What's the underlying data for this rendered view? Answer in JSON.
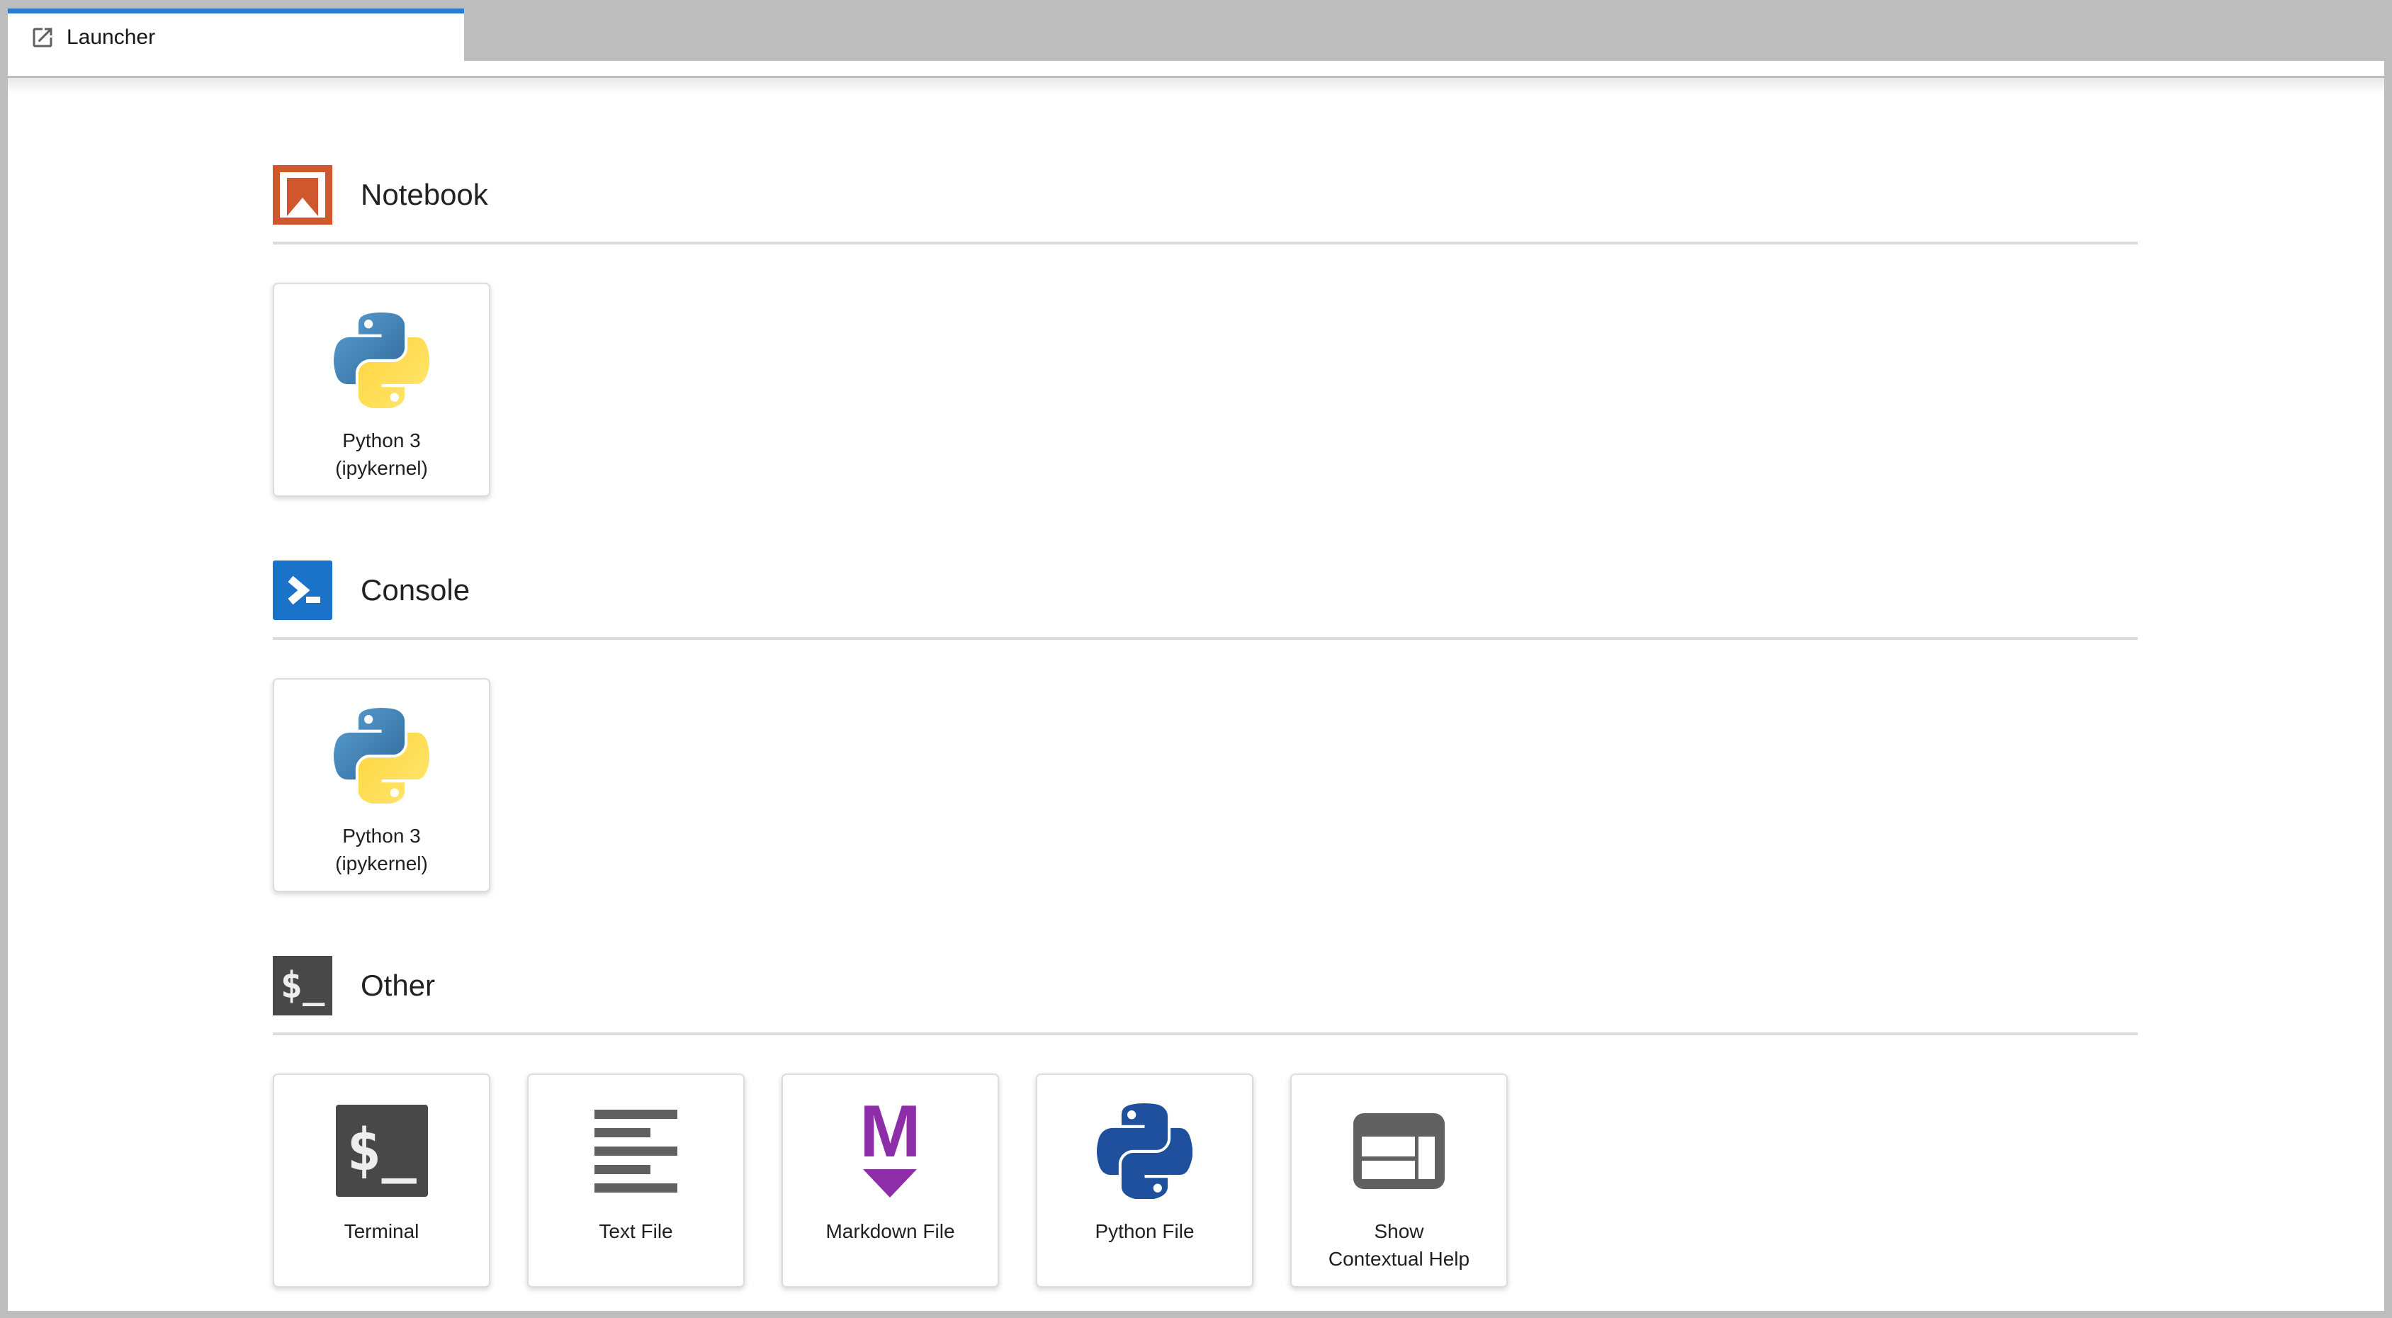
{
  "tab": {
    "label": "Launcher"
  },
  "sections": [
    {
      "label": "Notebook",
      "icon": "notebook-icon",
      "cards": [
        {
          "name": "Python 3 (ipykernel)",
          "icon": "python-logo-icon",
          "lines": [
            "Python 3",
            "(ipykernel)"
          ]
        }
      ]
    },
    {
      "label": "Console",
      "icon": "console-icon",
      "cards": [
        {
          "name": "Python 3 (ipykernel)",
          "icon": "python-logo-icon",
          "lines": [
            "Python 3",
            "(ipykernel)"
          ]
        }
      ]
    },
    {
      "label": "Other",
      "icon": "terminal-icon",
      "cards": [
        {
          "name": "Terminal",
          "icon": "terminal-icon",
          "lines": [
            "Terminal"
          ]
        },
        {
          "name": "Text File",
          "icon": "text-file-icon",
          "lines": [
            "Text File"
          ]
        },
        {
          "name": "Markdown File",
          "icon": "markdown-icon",
          "lines": [
            "Markdown File"
          ]
        },
        {
          "name": "Python File",
          "icon": "python-file-icon",
          "lines": [
            "Python File"
          ]
        },
        {
          "name": "Show Contextual Help",
          "icon": "contextual-help-icon",
          "lines": [
            "Show",
            "Contextual Help"
          ]
        }
      ]
    }
  ],
  "colors": {
    "frame_gray": "#bdbdbd",
    "tab_accent_blue": "#2d79d2",
    "notebook_orange": "#d0562d",
    "console_blue": "#1a73c8",
    "terminal_dark": "#484848",
    "text_icon_gray": "#606060",
    "markdown_purple": "#8d2da8",
    "python_file_blue": "#1f509e",
    "divider_gray": "#dbdbdb"
  }
}
